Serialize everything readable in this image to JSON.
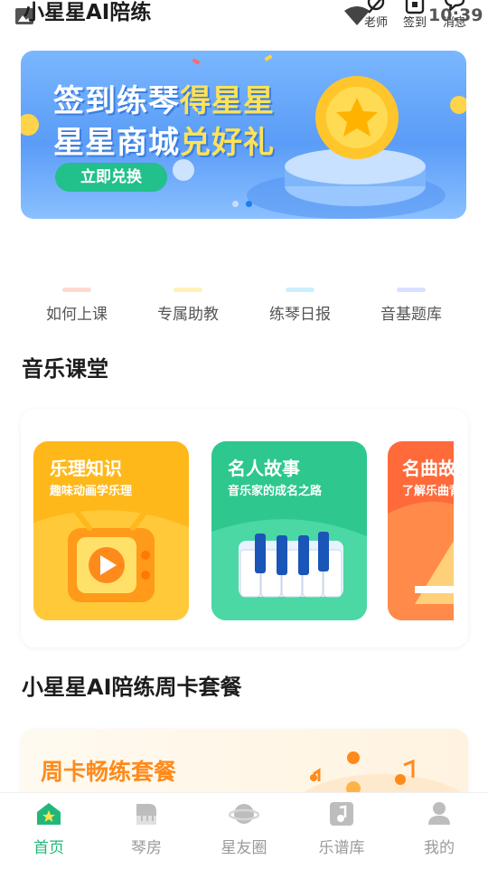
{
  "app": {
    "title": "小星星AI陪练"
  },
  "status": {
    "time": "10:39"
  },
  "header": {
    "teacher_label": "老师",
    "checkin_label": "签到",
    "messages_label": "消息"
  },
  "banner": {
    "line1_a": "签到练琴",
    "line1_b": "得星星",
    "line2_a": "星星商城",
    "line2_b": "兑好礼",
    "button_label": "立即兑换",
    "active_slide": 2,
    "slide_count": 2
  },
  "quick_entries": [
    {
      "label": "如何上课",
      "color": "#ffd9d0"
    },
    {
      "label": "专属助教",
      "color": "#fff1b8"
    },
    {
      "label": "练琴日报",
      "color": "#cdeeff"
    },
    {
      "label": "音基题库",
      "color": "#d9e0ff"
    }
  ],
  "music_class": {
    "title": "音乐课堂",
    "tiles": [
      {
        "title": "乐理知识",
        "subtitle": "趣味动画学乐理"
      },
      {
        "title": "名人故事",
        "subtitle": "音乐家的成名之路"
      },
      {
        "title": "名曲故事",
        "subtitle": "了解乐曲背后"
      }
    ]
  },
  "weekly": {
    "section_title": "小星星AI陪练周卡套餐",
    "card_title": "周卡畅练套餐"
  },
  "bottom_nav": [
    {
      "label": "首页",
      "icon": "home-star-icon",
      "active": true
    },
    {
      "label": "琴房",
      "icon": "piano-icon",
      "active": false
    },
    {
      "label": "星友圈",
      "icon": "planet-icon",
      "active": false
    },
    {
      "label": "乐谱库",
      "icon": "music-note-icon",
      "active": false
    },
    {
      "label": "我的",
      "icon": "person-icon",
      "active": false
    }
  ],
  "colors": {
    "accent": "#22b77a",
    "orange": "#ff8a1c",
    "banner_blue": "#5a9cf7"
  }
}
